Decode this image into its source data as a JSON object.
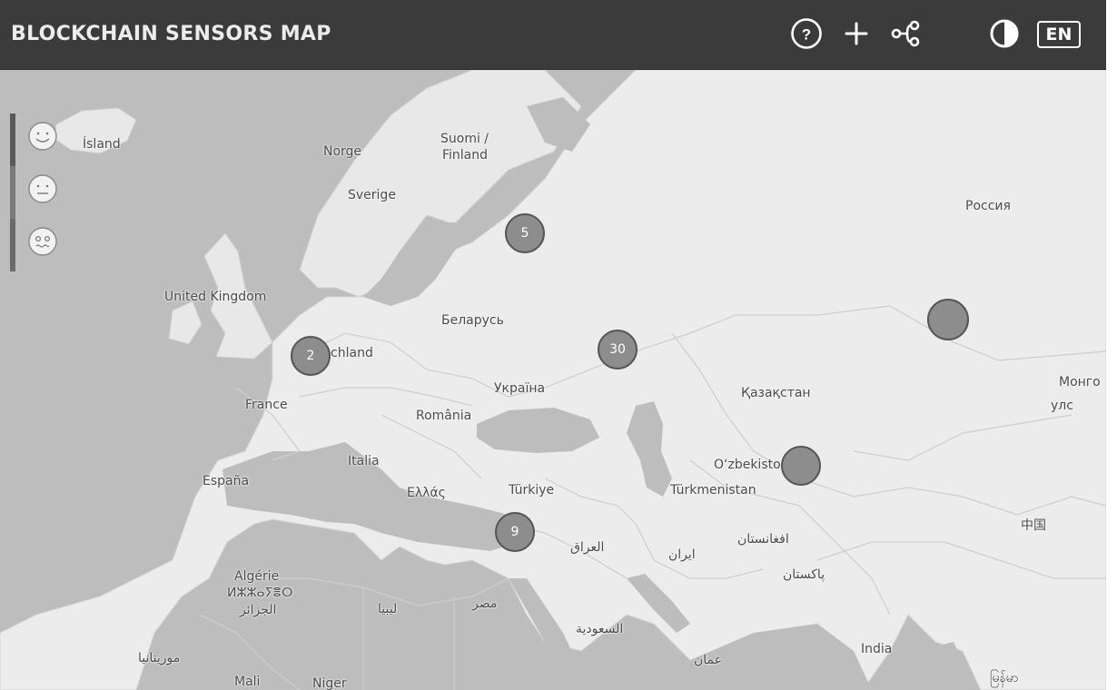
{
  "header": {
    "title": "BLOCKCHAIN SENSORS MAP",
    "lang_label": "EN"
  },
  "icons": {
    "help": "question-icon",
    "add": "plus-icon",
    "share": "share-icon",
    "contrast": "contrast-icon"
  },
  "legend": {
    "levels": [
      "happy-face-icon",
      "neutral-face-icon",
      "sad-face-icon"
    ]
  },
  "map": {
    "labels": {
      "island": "Ísland",
      "norge": "Norge",
      "suomi": "Suomi /",
      "finland": "Finland",
      "sverige": "Sverige",
      "russia": "Россия",
      "uk": "United Kingdom",
      "belarus": "Беларусь",
      "deutschland": "Deutschland",
      "france": "France",
      "ukraine": "Україна",
      "kazakhstan": "Қазақстан",
      "romania": "România",
      "mongolia": "Монго",
      "mongolia2": "улс",
      "italia": "Italia",
      "uzbekistan": "O‘zbekiston",
      "espana": "España",
      "greece": "Ελλάς",
      "turkiye": "Türkiye",
      "turkmenistan": "Türkmenistan",
      "china": "中国",
      "iraq": "العراق",
      "iran": "ایران",
      "afghanistan": "افغانستان",
      "algerie": "Algérie",
      "algerie2": "ⵍⵣⵣⴰⵢⴻⵔ",
      "algerie3": "الجزائر",
      "pakistan": "پاکستان",
      "libya": "ليبيا",
      "egypt": "مصر",
      "saudi": "السعودية",
      "india": "India",
      "mauritania": "موريتانيا",
      "oman": "عمان",
      "mali": "Mali",
      "niger": "Niger",
      "myanmar": "မြန်မာ"
    },
    "clusters": [
      {
        "count": "5"
      },
      {
        "count": "2"
      },
      {
        "count": "30"
      },
      {
        "count": ""
      },
      {
        "count": ""
      },
      {
        "count": "9"
      }
    ]
  },
  "colors": {
    "header_bg": "#3b3b3b",
    "land": "#ececec",
    "water": "#bdbdbd",
    "cluster": "#8d8d8d"
  }
}
